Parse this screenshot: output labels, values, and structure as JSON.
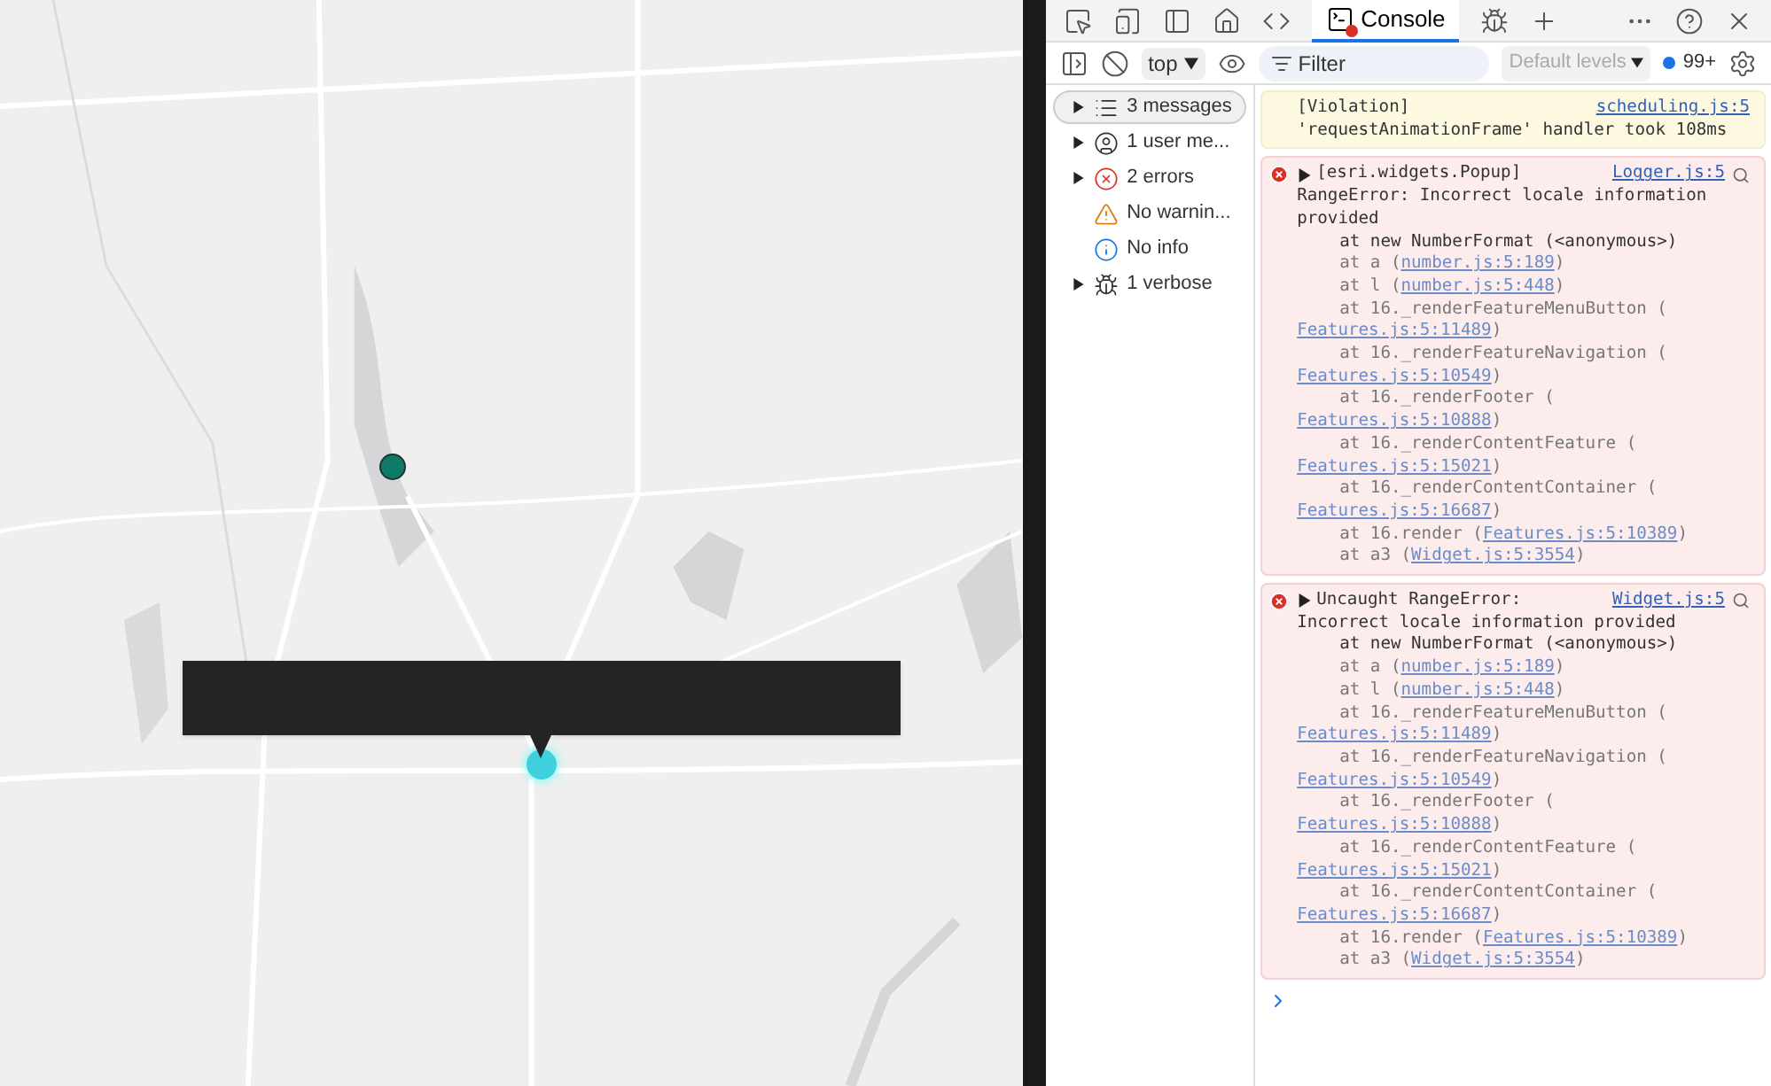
{
  "devtools": {
    "tabs": [
      {
        "label": "Console",
        "selected": true
      }
    ],
    "toolbar": {
      "context": "top",
      "filter_placeholder": "Filter",
      "levels": {
        "label": "Default levels",
        "disabled": true
      },
      "issues": "99+"
    },
    "sidebar": [
      {
        "kind": "list",
        "label": "3 messages",
        "expandable": true,
        "selected": true
      },
      {
        "kind": "user",
        "label": "1 user me...",
        "expandable": true,
        "selected": false
      },
      {
        "kind": "error",
        "label": "2 errors",
        "expandable": true,
        "selected": false
      },
      {
        "kind": "warning",
        "label": "No warnin...",
        "expandable": false,
        "selected": false
      },
      {
        "kind": "info",
        "label": "No info",
        "expandable": false,
        "selected": false
      },
      {
        "kind": "verbose",
        "label": "1 verbose",
        "expandable": true,
        "selected": false
      }
    ],
    "messages": [
      {
        "kind": "violation",
        "head": "[Violation]",
        "source": "scheduling.js:5",
        "body": "'requestAnimationFrame' handler took 108ms"
      },
      {
        "kind": "error",
        "expanded": false,
        "head": "[esri.widgets.Popup]",
        "source": "Logger.js:5",
        "body": "RangeError: Incorrect locale information provided",
        "frames": [
          {
            "text": "at new NumberFormat (<anonymous>)"
          },
          {
            "text": "at a (",
            "link": "number.js:5:189",
            "tail": ")"
          },
          {
            "text": "at l (",
            "link": "number.js:5:448",
            "tail": ")"
          },
          {
            "text": "at 16._renderFeatureMenuButton (",
            "link": "Features.js:5:11489",
            "tail": ")"
          },
          {
            "text": "at 16._renderFeatureNavigation (",
            "link": "Features.js:5:10549",
            "tail": ")"
          },
          {
            "text": "at 16._renderFooter (",
            "link": "Features.js:5:10888",
            "tail": ")"
          },
          {
            "text": "at 16._renderContentFeature (",
            "link": "Features.js:5:15021",
            "tail": ")"
          },
          {
            "text": "at 16._renderContentContainer (",
            "link": "Features.js:5:16687",
            "tail": ")"
          },
          {
            "text": "at 16.render (",
            "link": "Features.js:5:10389",
            "tail": ")"
          },
          {
            "text": "at a3 (",
            "link": "Widget.js:5:3554",
            "tail": ")"
          }
        ]
      },
      {
        "kind": "error",
        "expanded": false,
        "head": "Uncaught RangeError:",
        "source": "Widget.js:5",
        "body": "Incorrect locale information provided",
        "frames": [
          {
            "text": "at new NumberFormat (<anonymous>)"
          },
          {
            "text": "at a (",
            "link": "number.js:5:189",
            "tail": ")"
          },
          {
            "text": "at l (",
            "link": "number.js:5:448",
            "tail": ")"
          },
          {
            "text": "at 16._renderFeatureMenuButton (",
            "link": "Features.js:5:11489",
            "tail": ")"
          },
          {
            "text": "at 16._renderFeatureNavigation (",
            "link": "Features.js:5:10549",
            "tail": ")"
          },
          {
            "text": "at 16._renderFooter (",
            "link": "Features.js:5:10888",
            "tail": ")"
          },
          {
            "text": "at 16._renderContentFeature (",
            "link": "Features.js:5:15021",
            "tail": ")"
          },
          {
            "text": "at 16._renderContentContainer (",
            "link": "Features.js:5:16687",
            "tail": ")"
          },
          {
            "text": "at 16.render (",
            "link": "Features.js:5:10389",
            "tail": ")"
          },
          {
            "text": "at a3 (",
            "link": "Widget.js:5:3554",
            "tail": ")"
          }
        ]
      }
    ]
  }
}
